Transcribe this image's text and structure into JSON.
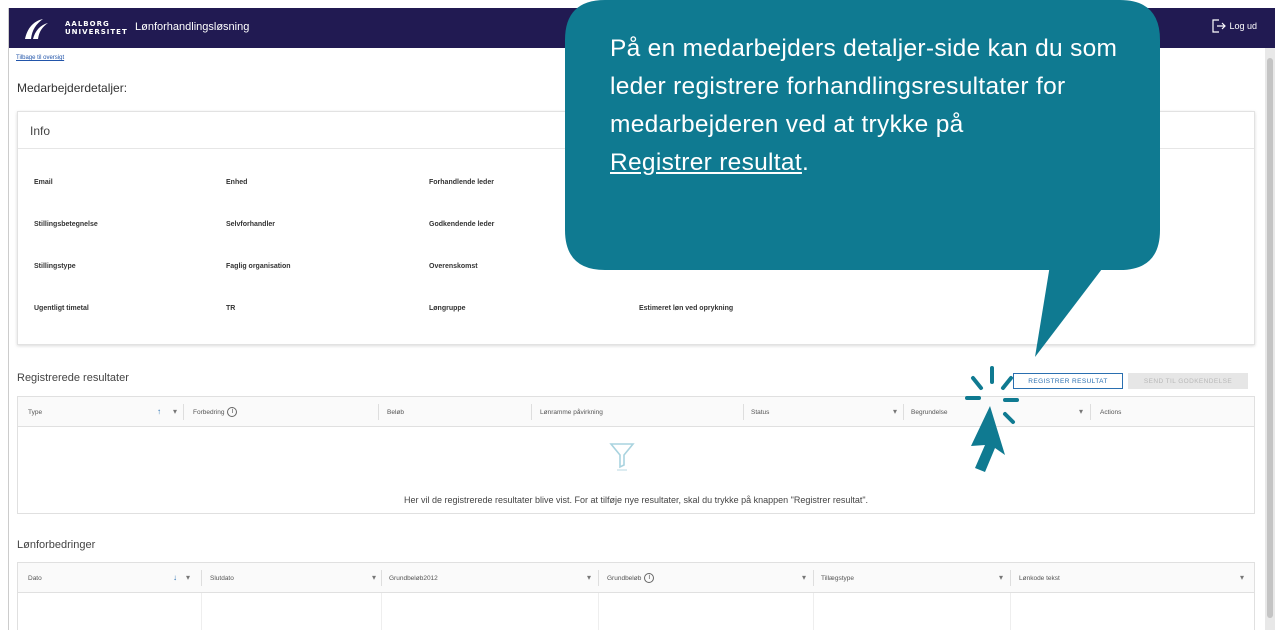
{
  "header": {
    "logo_line1": "AALBORG",
    "logo_line2": "UNIVERSITET",
    "app_title": "Lønforhandlingsløsning",
    "logout_label": "Log ud"
  },
  "back_link": "Tilbage til oversigt",
  "page_title": "Medarbejderdetaljer:",
  "info": {
    "title": "Info",
    "labels": {
      "email": "Email",
      "enhed": "Enhed",
      "forhandlende_leder": "Forhandlende leder",
      "stillingsbetegnelse": "Stillingsbetegnelse",
      "selvforhandler": "Selvforhandler",
      "godkendende_leder": "Godkendende leder",
      "stillingstype": "Stillingstype",
      "faglig_organisation": "Faglig organisation",
      "overenskomst": "Overenskomst",
      "ugentligt_timetal": "Ugentligt timetal",
      "tr": "TR",
      "longruppe": "Løngruppe",
      "estimeret_lon": "Estimeret løn ved oprykning"
    }
  },
  "results": {
    "title": "Registrerede resultater",
    "register_button": "REGISTRER RESULTAT",
    "send_button": "SEND TIL GODKENDELSE",
    "columns": [
      "Type",
      "Forbedring",
      "Beløb",
      "Lønramme påvirkning",
      "Status",
      "Begrundelse",
      "Actions"
    ],
    "empty_text": "Her vil de registrerede resultater blive vist. For at tilføje nye resultater, skal du trykke på knappen \"Registrer resultat\"."
  },
  "improvements": {
    "title": "Lønforbedringer",
    "columns": [
      "Dato",
      "Slutdato",
      "Grundbeløb2012",
      "Grundbeløb",
      "Tillægstype",
      "Lønkode tekst"
    ]
  },
  "callout": {
    "text": "På en medarbejders detaljer-side kan du som leder registrere forhandlingsresultater for medarbejderen ved at trykke på",
    "link_text": "Registrer resultat",
    "end": ".",
    "color": "#0f7a91"
  },
  "colors": {
    "topbar": "#211a52",
    "accent": "#2a6fb0"
  }
}
